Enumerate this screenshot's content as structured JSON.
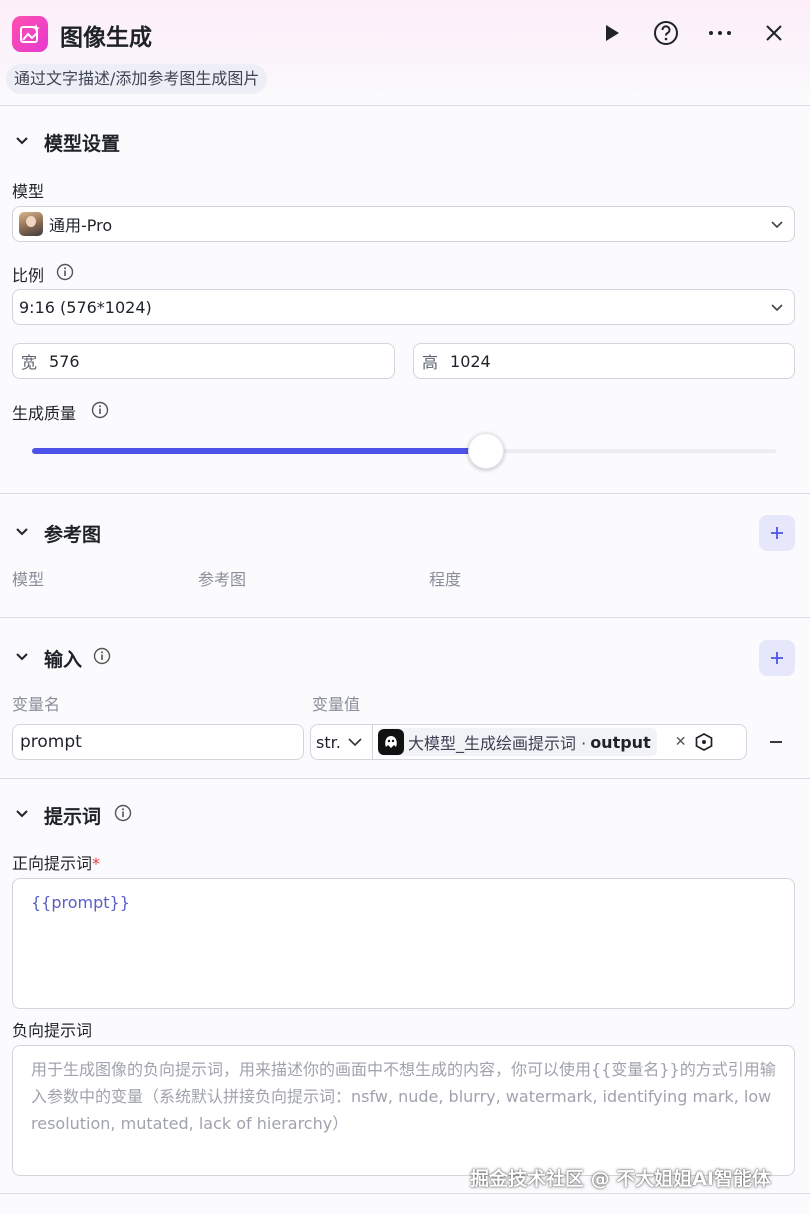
{
  "header": {
    "title": "图像生成",
    "description": "通过文字描述/添加参考图生成图片",
    "icon": "image-sparkle-icon",
    "actions": [
      "run-icon",
      "help-icon",
      "more-icon",
      "close-icon"
    ]
  },
  "model_settings": {
    "title": "模型设置",
    "model_label": "模型",
    "model_value": "通用-Pro",
    "ratio_label": "比例",
    "ratio_value": "9:16 (576*1024)",
    "width_label": "宽",
    "width_value": "576",
    "height_label": "高",
    "height_value": "1024",
    "quality_label": "生成质量",
    "quality_level": 0.61
  },
  "reference": {
    "title": "参考图",
    "columns": [
      "模型",
      "参考图",
      "程度"
    ]
  },
  "input": {
    "title": "输入",
    "col_name": "变量名",
    "col_value": "变量值",
    "var_name": "prompt",
    "type": "str.",
    "ref_node": "大模型_生成绘画提示词 ·",
    "ref_field": "output"
  },
  "prompts": {
    "title": "提示词",
    "positive_label": "正向提示词",
    "required_mark": "*",
    "positive_value": "{{prompt}}",
    "negative_label": "负向提示词",
    "negative_placeholder": "用于生成图像的负向提示词，用来描述你的画面中不想生成的内容，你可以使用{{变量名}}的方式引用输入参数中的变量（系统默认拼接负向提示词：nsfw, nude, blurry, watermark, identifying mark, low resolution, mutated, lack of hierarchy）"
  },
  "watermark": "掘金技术社区 @ 不大姐姐AI智能体",
  "colors": {
    "accent": "#4d53e8",
    "app_icon": "#ff4fb0",
    "prompt_text": "#5a5fc7"
  }
}
